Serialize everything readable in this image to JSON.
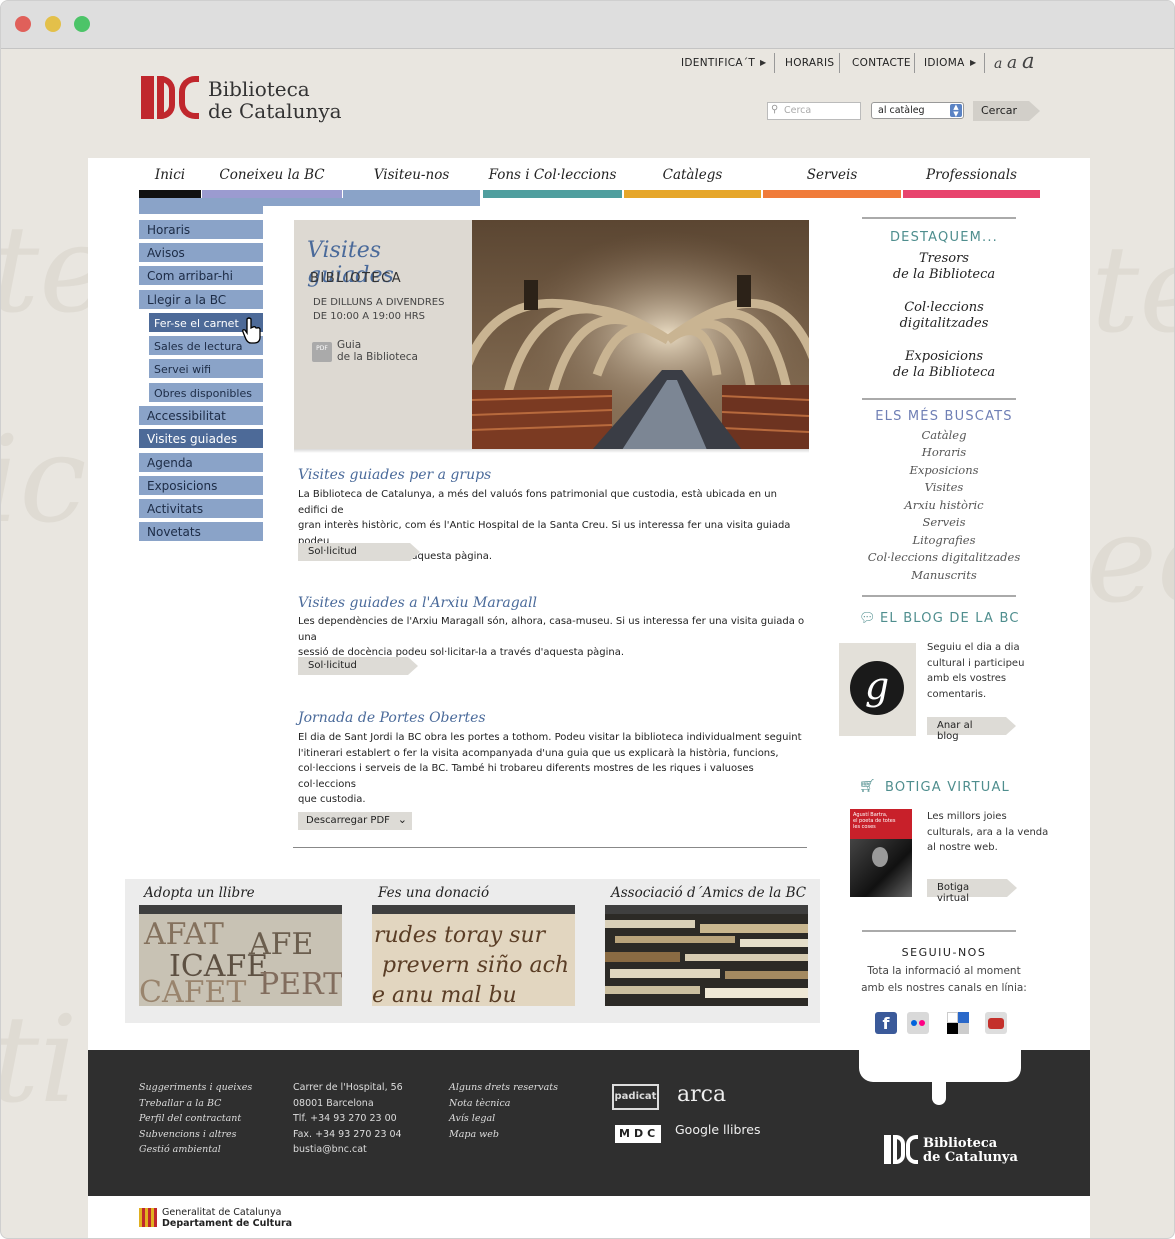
{
  "header": {
    "logo_mark": "BC",
    "logo_line1": "Biblioteca",
    "logo_line2": "de Catalunya",
    "top_links": [
      "IDENTIFICA´T",
      "HORARIS",
      "CONTACTE",
      "IDIOMA"
    ],
    "font_sizes": [
      "a",
      "a",
      "a"
    ],
    "search": {
      "placeholder": "Cerca",
      "scope": "al catàleg",
      "button": "Cercar"
    }
  },
  "nav": {
    "items": [
      {
        "label": "Inici",
        "color": "#111111"
      },
      {
        "label": "Coneixeu la BC",
        "color": "#9b9bd0"
      },
      {
        "label": "Visiteu-nos",
        "color": "#8aa3c8"
      },
      {
        "label": "Fons i Col·leccions",
        "color": "#4f9e9e"
      },
      {
        "label": "Catàlegs",
        "color": "#e6a62a"
      },
      {
        "label": "Serveis",
        "color": "#f07b3a"
      },
      {
        "label": "Professionals",
        "color": "#e8446d"
      }
    ]
  },
  "sidebar": {
    "items": [
      {
        "label": "Horaris"
      },
      {
        "label": "Avisos"
      },
      {
        "label": "Com arribar-hi"
      },
      {
        "label": "Llegir a la BC"
      },
      {
        "label": "Fer-se el carnet"
      },
      {
        "label": "Sales de lectura"
      },
      {
        "label": "Servei wifi"
      },
      {
        "label": "Obres disponibles"
      },
      {
        "label": "Accessibilitat"
      },
      {
        "label": "Visites guiades"
      },
      {
        "label": "Agenda"
      },
      {
        "label": "Exposicions"
      },
      {
        "label": "Activitats"
      },
      {
        "label": "Novetats"
      }
    ]
  },
  "hero": {
    "title": "Visites guiades",
    "subtitle": "BIBLIOTECA",
    "line1": "DE DILLUNS A DIVENDRES",
    "line2": "DE 10:00 A 19:00 HRS",
    "pdf_icon": "PDF",
    "guide1": "Guia",
    "guide2": "de la Biblioteca"
  },
  "sections": [
    {
      "title": "Visites guiades per a grups",
      "lines": [
        "La Biblioteca de Catalunya, a més del valuós fons patrimonial que custodia, està ubicada en un edifici  de",
        "gran interès històric, com és l'Antic Hospital de la Santa Creu. Si us interessa fer una visita guiada podeu",
        "sol·licitar-la a través d'aquesta pàgina."
      ],
      "button": "Sol·licitud"
    },
    {
      "title": "Visites guiades a l'Arxiu Maragall",
      "lines": [
        "Les dependències de l'Arxiu Maragall són, alhora, casa-museu. Si us interessa fer una visita guiada o una",
        "sessió de docència podeu sol·licitar-la a través d'aquesta pàgina."
      ],
      "button": "Sol·licitud"
    },
    {
      "title": "Jornada de Portes Obertes",
      "lines": [
        "El dia de Sant Jordi la BC obra les portes a tothom. Podeu visitar la biblioteca individualment seguint",
        "l'itinerari establert o fer la visita acompanyada d'una guia que us explicarà la història, funcions,",
        "col·leccions i serveis de la BC. També hi trobareu diferents mostres de les riques i valuoses col·leccions",
        "que custodia."
      ],
      "button": "Descarregar PDF"
    }
  ],
  "promos": [
    {
      "title": "Adopta un llibre"
    },
    {
      "title": "Fes una donació"
    },
    {
      "title": "Associació d´Amics de la BC"
    }
  ],
  "right": {
    "destaquem_title": "DESTAQUEM...",
    "destaquem": [
      {
        "l1": "Tresors",
        "l2": "de la Biblioteca"
      },
      {
        "l1": "Col·leccions",
        "l2": "digitalitzades"
      },
      {
        "l1": "Exposicions",
        "l2": "de la Biblioteca"
      }
    ],
    "buscats_title": "ELS MÉS BUSCATS",
    "buscats": [
      "Catàleg",
      "Horaris",
      "Exposicions",
      "Visites",
      "Arxiu històric",
      "Serveis",
      "Litografies",
      "Col·leccions digitalitzades",
      "Manuscrits"
    ],
    "blog_title": "EL BLOG DE LA BC",
    "blog_letter": "g",
    "blog_lines": [
      "Seguiu el dia a dia",
      "cultural i participeu",
      "amb els vostres",
      "comentaris."
    ],
    "blog_button": "Anar al blog",
    "shop_title": "BOTIGA VIRTUAL",
    "shop_book_lines": [
      "Agustí Bartra,",
      "el poeta de totes",
      "les coses"
    ],
    "shop_lines": [
      "Les millors joies",
      "culturals, ara a la venda",
      "al nostre web."
    ],
    "shop_button": "Botiga virtual",
    "follow_title": "SEGUIU-NOS",
    "follow_l1": "Tota la informació al moment",
    "follow_l2": "amb els nostres canals en línia:"
  },
  "footer": {
    "col1": [
      "Suggeriments i queixes",
      "Treballar a la BC",
      "Perfil del contractant",
      "Subvencions i altres",
      "Gestió ambiental"
    ],
    "col2": [
      "Carrer de l'Hospital,  56",
      "08001 Barcelona",
      "Tlf. +34 93 270 23 00",
      "Fax. +34 93 270 23 04",
      "bustia@bnc.cat"
    ],
    "col3": [
      "Alguns drets reservats",
      "Nota tècnica",
      "Avís legal",
      "Mapa web"
    ],
    "logos": [
      "padicat",
      "arca",
      "MDC",
      "Google llibres"
    ],
    "footer_logo_mark": "BC",
    "footer_logo1": "Biblioteca",
    "footer_logo2": "de Catalunya",
    "gov1": "Generalitat de Catalunya",
    "gov2": "Departament de Cultura"
  },
  "colors": {
    "accent_blue": "#8aa3c8",
    "active_blue": "#4d6a98",
    "footer_bg": "#2f2f2f",
    "brand_red": "#c0272d"
  }
}
